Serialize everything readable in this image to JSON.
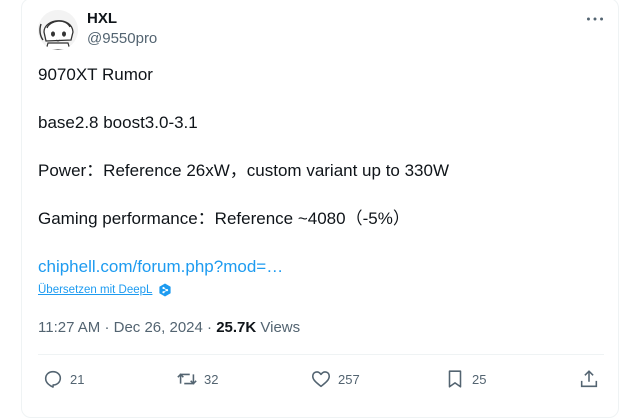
{
  "author": {
    "name": "HXL",
    "handle": "@9550pro",
    "avatar_icon": "anime-avatar-icon"
  },
  "post": {
    "lines": [
      "9070XT Rumor",
      "base2.8 boost3.0-3.1",
      "Power：Reference 26xW，custom variant up to 330W",
      "Gaming performance：Reference ~4080（-5%）"
    ],
    "link_text": "chiphell.com/forum.php?mod=…",
    "translate_label": "Übersetzen mit DeepL"
  },
  "meta": {
    "time": "11:27 AM",
    "date": "Dec 26, 2024",
    "separator": "·",
    "views_count": "25.7K",
    "views_label": "Views"
  },
  "actions": {
    "replies": "21",
    "reposts": "32",
    "likes": "257",
    "bookmarks": "25"
  },
  "colors": {
    "link": "#1d9bf0",
    "muted": "#536471",
    "text": "#0f1419"
  }
}
